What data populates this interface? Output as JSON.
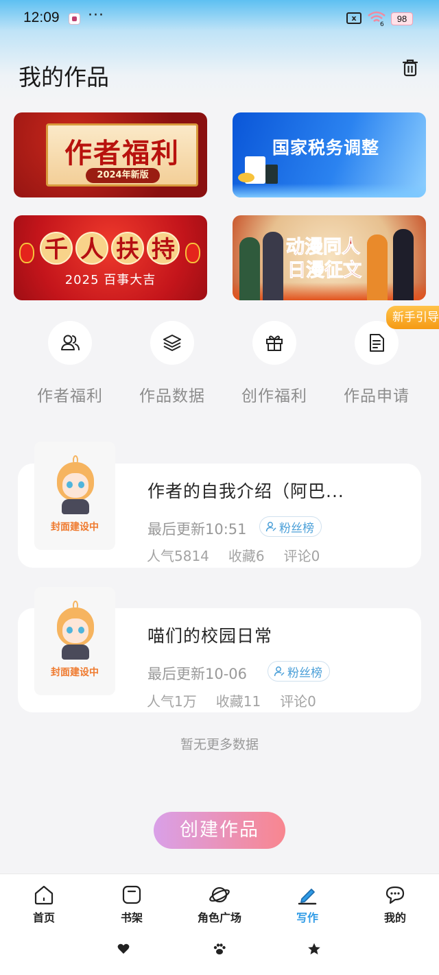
{
  "status_bar": {
    "time": "12:09",
    "more": "···",
    "sim_label": "x",
    "network_label": "6",
    "battery": "98"
  },
  "header": {
    "title": "我的作品",
    "trash_icon": "trash-icon"
  },
  "banners": [
    {
      "title": "作者福利",
      "tag": "2024年新版",
      "theme_color": "#b8120e"
    },
    {
      "title": "国家税务调整",
      "theme_color": "#0a56d8"
    },
    {
      "title_chars": [
        "千",
        "人",
        "扶",
        "持"
      ],
      "subtitle": "2025 百事大吉",
      "theme_color": "#c4151b"
    },
    {
      "line1": "动漫同人",
      "line2": "日漫征文",
      "theme_color": "#c41a1a"
    }
  ],
  "quick_actions": [
    {
      "label": "作者福利",
      "icon": "users-icon"
    },
    {
      "label": "作品数据",
      "icon": "layers-icon"
    },
    {
      "label": "创作福利",
      "icon": "gift-icon"
    },
    {
      "label": "作品申请",
      "icon": "document-icon"
    }
  ],
  "guide_tab": "新手引导",
  "works": [
    {
      "cover_label": "封面建设中",
      "title": "作者的自我介绍（阿巴...",
      "updated": "最后更新10:51",
      "fans": "粉丝榜",
      "stats": [
        "人气5814",
        "收藏6",
        "评论0"
      ]
    },
    {
      "cover_label": "封面建设中",
      "title": "喵们的校园日常",
      "updated": "最后更新10-06",
      "fans": "粉丝榜",
      "stats": [
        "人气1万",
        "收藏11",
        "评论0"
      ]
    }
  ],
  "no_more": "暂无更多数据",
  "create_button": "创建作品",
  "bottom_nav": [
    {
      "label": "首页",
      "icon": "home-icon",
      "active": false
    },
    {
      "label": "书架",
      "icon": "bookshelf-icon",
      "active": false
    },
    {
      "label": "角色广场",
      "icon": "planet-icon",
      "active": false
    },
    {
      "label": "写作",
      "icon": "pen-icon",
      "active": true
    },
    {
      "label": "我的",
      "icon": "chat-icon",
      "active": false
    }
  ],
  "accent_color": "#2f9be6"
}
